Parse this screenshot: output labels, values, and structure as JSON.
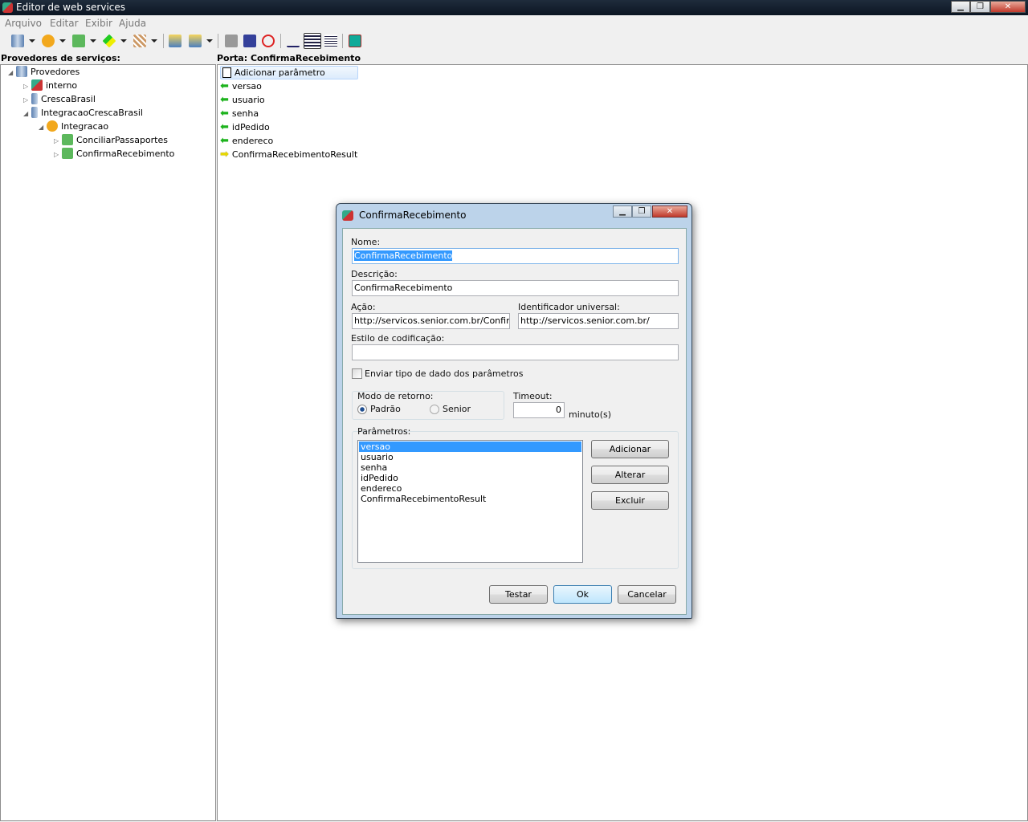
{
  "window": {
    "title": "Editor de web services",
    "controls": {
      "minimize": "▁",
      "restore": "❐",
      "close": "✕"
    }
  },
  "menu": [
    "Arquivo",
    "Editar",
    "Exibir",
    "Ajuda"
  ],
  "toolbar": [
    "providers-icon",
    "service-icon",
    "port-icon",
    "parameter-icon",
    "schema-icon",
    "import-icon",
    "export-icon",
    "stop-icon",
    "save-icon",
    "undo-icon",
    "small-icons-view",
    "list-view",
    "details-view",
    "run-icon"
  ],
  "left_panel": {
    "header": "Provedores de serviços:",
    "tree": [
      {
        "label": "Provedores"
      },
      {
        "label": "interno"
      },
      {
        "label": "CrescaBrasil"
      },
      {
        "label": "IntegracaoCrescaBrasil"
      },
      {
        "label": "Integracao"
      },
      {
        "label": "ConciliarPassaportes"
      },
      {
        "label": "ConfirmaRecebimento"
      }
    ]
  },
  "right_panel": {
    "header": "Porta: ConfirmaRecebimento",
    "add_label": "Adicionar parâmetro",
    "params": [
      {
        "label": "versao",
        "dir": "in"
      },
      {
        "label": "usuario",
        "dir": "in"
      },
      {
        "label": "senha",
        "dir": "in"
      },
      {
        "label": "idPedido",
        "dir": "in"
      },
      {
        "label": "endereco",
        "dir": "in"
      },
      {
        "label": "ConfirmaRecebimentoResult",
        "dir": "out"
      }
    ]
  },
  "dialog": {
    "title": "ConfirmaRecebimento",
    "nome_label": "Nome:",
    "nome": "ConfirmaRecebimento",
    "descricao_label": "Descrição:",
    "descricao": "ConfirmaRecebimento",
    "acao_label": "Ação:",
    "acao": "http://servicos.senior.com.br/ConfirmaRecebimento",
    "uri_label": "Identificador universal:",
    "uri": "http://servicos.senior.com.br/",
    "estilo_label": "Estilo de codificação:",
    "estilo": "",
    "enviar_label": "Enviar tipo de dado dos parâmetros",
    "modo_label": "Modo de retorno:",
    "padrao": "Padrão",
    "senior": "Senior",
    "timeout_label": "Timeout:",
    "timeout": "0",
    "timeout_unit": "minuto(s)",
    "params_label": "Parâmetros:",
    "params": [
      "versao",
      "usuario",
      "senha",
      "idPedido",
      "endereco",
      "ConfirmaRecebimentoResult"
    ],
    "adicionar": "Adicionar",
    "alterar": "Alterar",
    "excluir": "Excluir",
    "testar": "Testar",
    "ok": "Ok",
    "cancelar": "Cancelar"
  }
}
